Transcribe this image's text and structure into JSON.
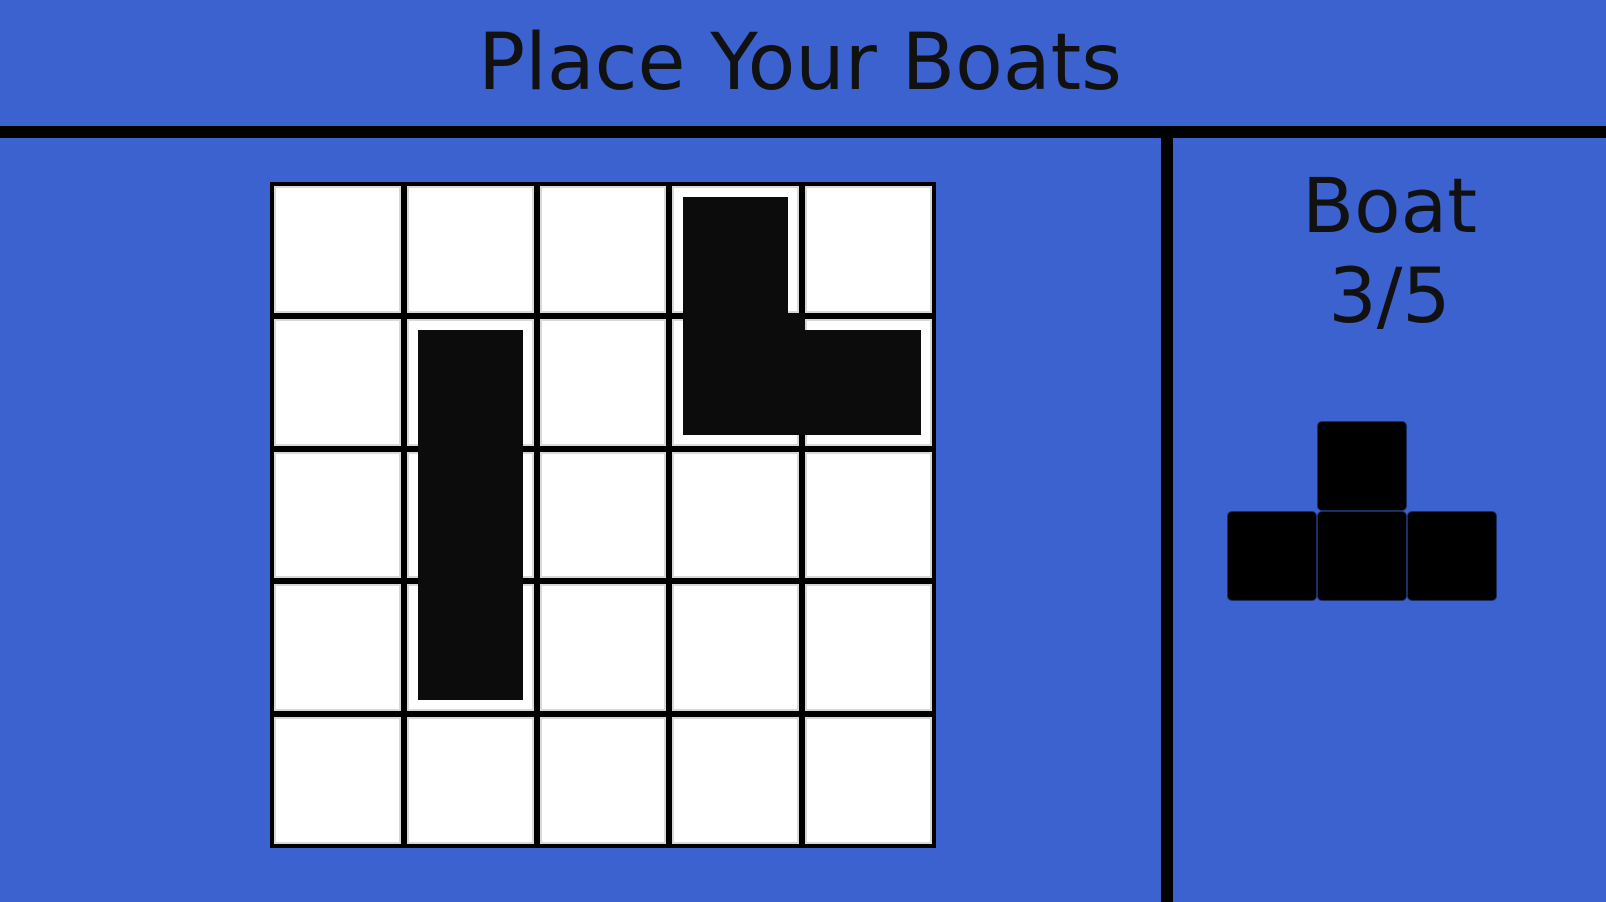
{
  "header": {
    "title": "Place Your Boats"
  },
  "board": {
    "rows": 5,
    "cols": 5,
    "placed_boats": [
      {
        "name": "boat-1",
        "cells": [
          [
            1,
            1
          ],
          [
            2,
            1
          ],
          [
            3,
            1
          ]
        ]
      },
      {
        "name": "boat-2",
        "cells": [
          [
            0,
            3
          ],
          [
            1,
            3
          ],
          [
            1,
            4
          ]
        ]
      }
    ]
  },
  "sidebar": {
    "label": "Boat",
    "counter": "3/5",
    "current_boat_cells": [
      [
        0,
        1
      ],
      [
        1,
        0
      ],
      [
        1,
        1
      ],
      [
        1,
        2
      ]
    ]
  },
  "colors": {
    "background": "#3b62cf",
    "cell": "#ffffff",
    "boat": "#0c0c0c",
    "line": "#000000"
  }
}
